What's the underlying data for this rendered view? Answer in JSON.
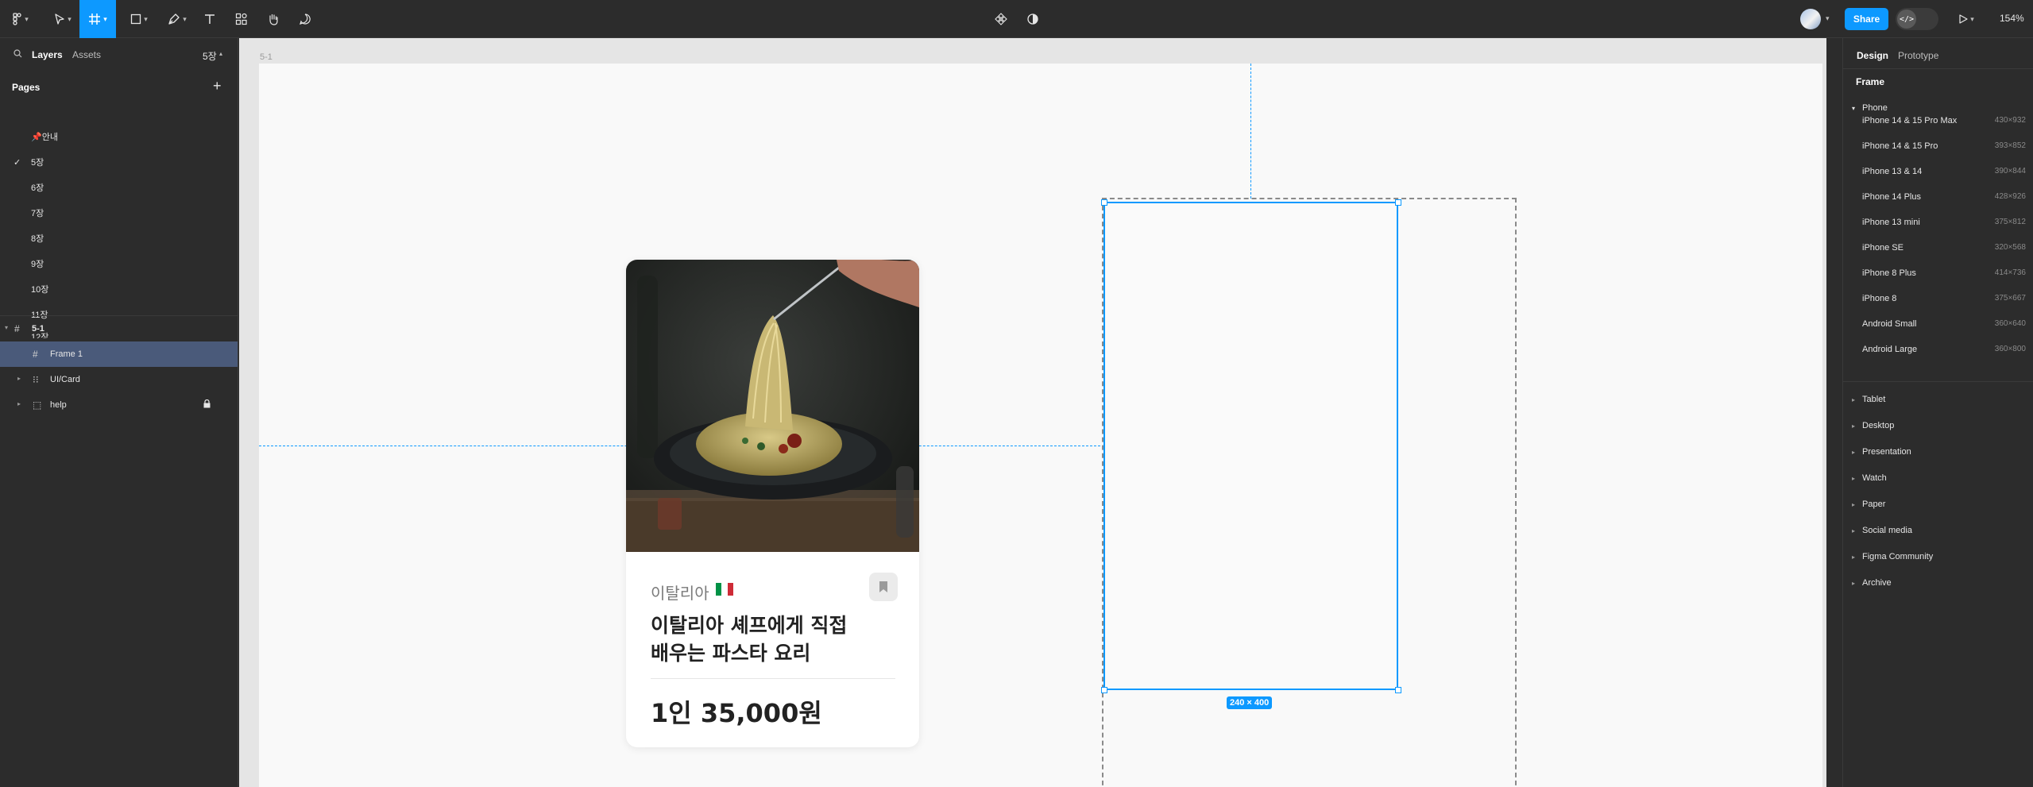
{
  "toolbar": {
    "share_label": "Share",
    "zoom": "154%",
    "dev_mode_label": "</>"
  },
  "left_panel": {
    "tab_layers": "Layers",
    "tab_assets": "Assets",
    "current_page": "5장",
    "pages_title": "Pages",
    "pages": [
      {
        "label": "📌안내",
        "checked": false
      },
      {
        "label": "5장",
        "checked": true
      },
      {
        "label": "6장",
        "checked": false
      },
      {
        "label": "7장",
        "checked": false
      },
      {
        "label": "8장",
        "checked": false
      },
      {
        "label": "9장",
        "checked": false
      },
      {
        "label": "10장",
        "checked": false
      },
      {
        "label": "11장",
        "checked": false
      },
      {
        "label": "12장",
        "checked": false
      }
    ],
    "layers": [
      {
        "label": "5-1",
        "icon": "frame-icon",
        "level": 0,
        "selected": false
      },
      {
        "label": "Frame 1",
        "icon": "frame-icon",
        "level": 1,
        "selected": true
      },
      {
        "label": "UI/Card",
        "icon": "autolayout-icon",
        "level": 1,
        "selected": false
      },
      {
        "label": "help",
        "icon": "section-icon",
        "level": 1,
        "selected": false,
        "locked": true
      }
    ]
  },
  "canvas": {
    "frame_label": "5-1",
    "selection_size": "240 × 400",
    "card": {
      "category": "이탈리아",
      "flag_colors": [
        "#009246",
        "#ffffff",
        "#ce2b37"
      ],
      "title_line1": "이탈리아 셰프에게 직접",
      "title_line2": "배우는 파스타 요리",
      "price": "1인 35,000원"
    }
  },
  "right_panel": {
    "tab_design": "Design",
    "tab_prototype": "Prototype",
    "section_title": "Frame",
    "phone_group": "Phone",
    "devices": [
      {
        "name": "iPhone 14 & 15 Pro Max",
        "size": "430×932"
      },
      {
        "name": "iPhone 14 & 15 Pro",
        "size": "393×852"
      },
      {
        "name": "iPhone 13 & 14",
        "size": "390×844"
      },
      {
        "name": "iPhone 14 Plus",
        "size": "428×926"
      },
      {
        "name": "iPhone 13 mini",
        "size": "375×812"
      },
      {
        "name": "iPhone SE",
        "size": "320×568"
      },
      {
        "name": "iPhone 8 Plus",
        "size": "414×736"
      },
      {
        "name": "iPhone 8",
        "size": "375×667"
      },
      {
        "name": "Android Small",
        "size": "360×640"
      },
      {
        "name": "Android Large",
        "size": "360×800"
      }
    ],
    "groups": [
      "Tablet",
      "Desktop",
      "Presentation",
      "Watch",
      "Paper",
      "Social media",
      "Figma Community",
      "Archive"
    ]
  }
}
